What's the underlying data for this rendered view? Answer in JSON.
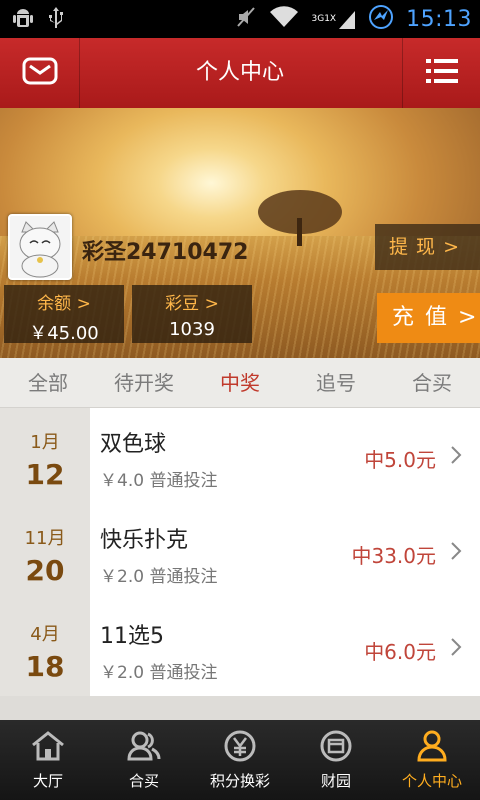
{
  "status_bar": {
    "time": "15:13",
    "network": "3G",
    "network_speed": "1X"
  },
  "header": {
    "title": "个人中心"
  },
  "profile": {
    "username": "彩圣24710472",
    "withdraw_label": "提 现 >",
    "recharge_label": "充 值 >",
    "balance_label": "余额 >",
    "balance_value": "￥45.00",
    "beans_label": "彩豆 >",
    "beans_value": "1039"
  },
  "tabs": [
    "全部",
    "待开奖",
    "中奖",
    "追号",
    "合买"
  ],
  "active_tab": "中奖",
  "records": [
    {
      "month": "1月",
      "day": "12",
      "name": "双色球",
      "detail": "￥4.0 普通投注",
      "prize": "中5.0元"
    },
    {
      "month": "11月",
      "day": "20",
      "name": "快乐扑克",
      "detail": "￥2.0 普通投注",
      "prize": "中33.0元"
    },
    {
      "month": "4月",
      "day": "18",
      "name": "11选5",
      "detail": "￥2.0 普通投注",
      "prize": "中6.0元"
    }
  ],
  "bottom_nav": [
    "大厅",
    "合买",
    "积分换彩",
    "财园",
    "个人中心"
  ],
  "colors": {
    "header": "#b71c1c",
    "accent": "#ef8b14",
    "active_nav": "#ffad1f",
    "prize": "#c0453a"
  },
  "icons": {
    "status_left": [
      "android-debug-icon",
      "usb-icon"
    ],
    "status_right": [
      "mute-icon",
      "wifi-icon",
      "signal-icon",
      "sync-icon"
    ],
    "header_left": "mail-icon",
    "header_right": "menu-icon",
    "nav": [
      "home-icon",
      "group-buy-icon",
      "yen-icon",
      "wallet-icon",
      "user-icon"
    ]
  }
}
